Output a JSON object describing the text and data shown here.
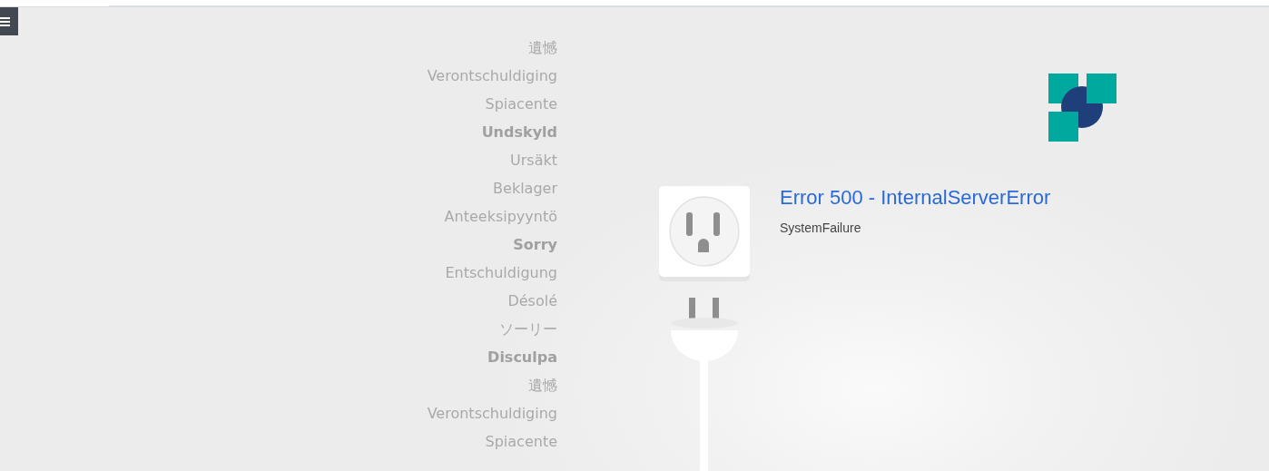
{
  "apology_words": [
    {
      "text": "遺憾",
      "bold": false
    },
    {
      "text": "Verontschuldiging",
      "bold": false
    },
    {
      "text": "Spiacente",
      "bold": false
    },
    {
      "text": "Undskyld",
      "bold": true
    },
    {
      "text": "Ursäkt",
      "bold": false
    },
    {
      "text": "Beklager",
      "bold": false
    },
    {
      "text": "Anteeksipyyntö",
      "bold": false
    },
    {
      "text": "Sorry",
      "bold": true
    },
    {
      "text": "Entschuldigung",
      "bold": false
    },
    {
      "text": "Désolé",
      "bold": false
    },
    {
      "text": "ソーリー",
      "bold": false
    },
    {
      "text": "Disculpa",
      "bold": true
    },
    {
      "text": "遺憾",
      "bold": false
    },
    {
      "text": "Verontschuldiging",
      "bold": false
    },
    {
      "text": "Spiacente",
      "bold": false
    }
  ],
  "error": {
    "title": "Error 500 - InternalServerError",
    "message": "SystemFailure"
  }
}
